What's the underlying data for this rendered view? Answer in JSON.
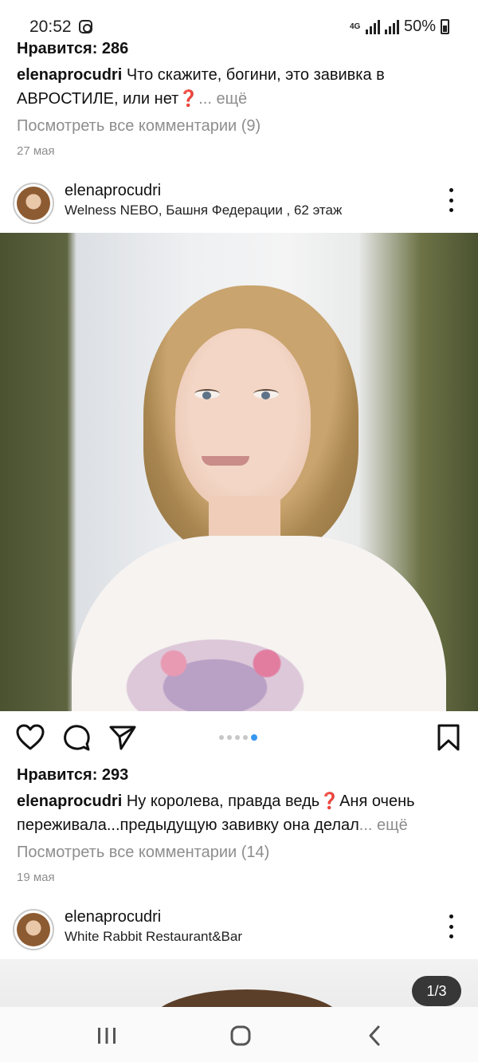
{
  "status_bar": {
    "time": "20:52",
    "network": "4G",
    "battery": "50%"
  },
  "post1_tail": {
    "likes": "Нравится: 286",
    "username": "elenaprocudri",
    "caption": "Что скажите, богини, это завивка в АВРОСТИЛЕ, или нет❓",
    "more": "... ещё",
    "view_comments": "Посмотреть все комментарии (9)",
    "date": "27 мая"
  },
  "post2": {
    "username": "elenaprocudri",
    "location": "Welness NEBO, Башня Федерации , 62 этаж",
    "carousel_total": 5,
    "carousel_active": 5,
    "likes": "Нравится: 293",
    "caption_user": "elenaprocudri",
    "caption": "Ну королева, правда ведь❓Аня очень переживала...предыдущую завивку она делал",
    "more": "... ещё",
    "view_comments": "Посмотреть все комментарии (14)",
    "date": "19 мая"
  },
  "post3": {
    "username": "elenaprocudri",
    "location": "White Rabbit Restaurant&Bar",
    "counter": "1/3"
  },
  "icons": {
    "like": "heart-icon",
    "comment": "comment-icon",
    "share": "send-icon",
    "save": "bookmark-icon",
    "menu": "more-vertical-icon",
    "nav_recent": "recent-apps-icon",
    "nav_home": "home-icon",
    "nav_back": "back-icon"
  },
  "colors": {
    "accent": "#3897f0",
    "secondary_text": "#8e8e8e"
  }
}
